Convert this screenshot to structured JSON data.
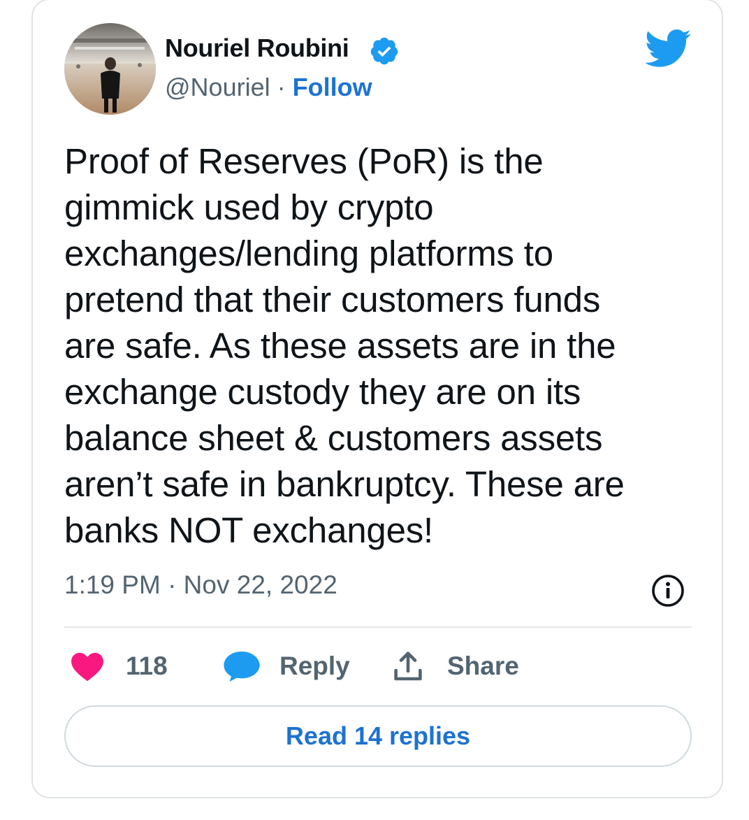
{
  "author": {
    "name": "Nouriel Roubini",
    "handle": "@Nouriel",
    "separator": "·",
    "follow_label": "Follow",
    "verified": true
  },
  "tweet": {
    "text": "Proof of Reserves (PoR) is the\ngimmick used by crypto\nexchanges/lending platforms to\npretend that their customers funds\nare safe. As these assets are in the\nexchange custody they are on its\nbalance sheet & customers assets\naren’t safe in bankruptcy. These are\nbanks NOT exchanges!",
    "timestamp": "1:19 PM · Nov 22, 2022"
  },
  "actions": {
    "like_count": "118",
    "reply_label": "Reply",
    "share_label": "Share"
  },
  "footer": {
    "read_replies_label": "Read 14 replies"
  },
  "icons": {
    "brand": "twitter-bird-icon",
    "verified": "verified-badge-icon",
    "info": "info-icon",
    "like": "heart-icon",
    "reply": "speech-bubble-icon",
    "share": "share-upload-icon"
  },
  "colors": {
    "twitter_blue": "#1d9bf0",
    "link_blue": "#1d72d2",
    "like_pink": "#f91880",
    "text_primary": "#0f1419",
    "text_secondary": "#536471",
    "border": "#cfd9de"
  }
}
